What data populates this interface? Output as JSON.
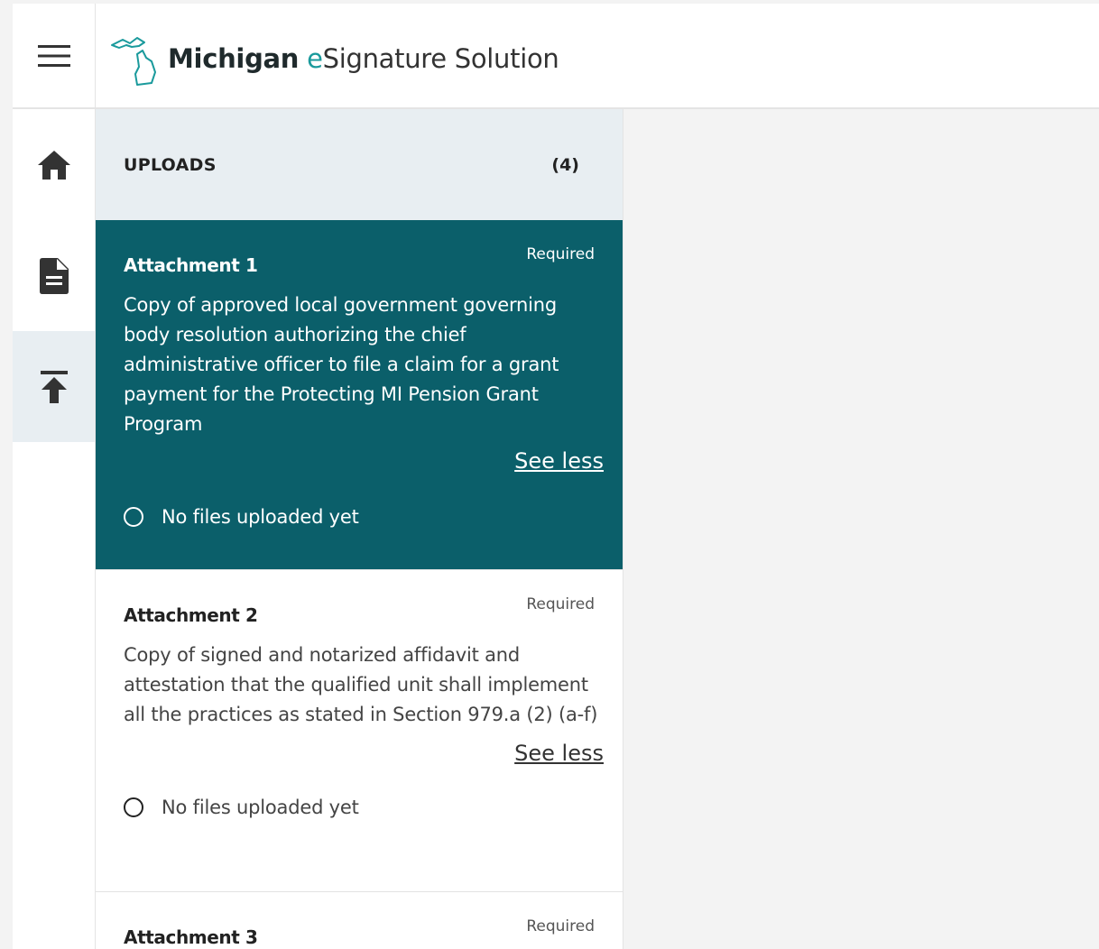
{
  "header": {
    "logo_bold": "Michigan",
    "logo_e": "e",
    "logo_rest": "Signature Solution"
  },
  "nav": {
    "items": [
      {
        "name": "home",
        "icon": "home-icon",
        "active": false
      },
      {
        "name": "documents",
        "icon": "document-icon",
        "active": false
      },
      {
        "name": "uploads",
        "icon": "upload-icon",
        "active": true
      }
    ]
  },
  "uploads": {
    "title": "UPLOADS",
    "count": "(4)",
    "items": [
      {
        "name": "Attachment 1",
        "required": "Required",
        "description": "Copy of approved local government governing body resolution authorizing the chief administrative officer to file a claim for a grant payment for the Protecting MI Pension Grant Program",
        "toggle": "See less",
        "status": "No files uploaded yet"
      },
      {
        "name": "Attachment 2",
        "required": "Required",
        "description": "Copy of signed and notarized affidavit and attestation that the qualified unit shall implement all the practices as stated in Section 979.a (2) (a-f)",
        "toggle": "See less",
        "status": "No files uploaded yet"
      },
      {
        "name": "Attachment 3",
        "required": "Required"
      }
    ]
  },
  "colors": {
    "active_card": "#0b5f6a",
    "brand_teal": "#1a9a9c",
    "panel_header": "#e8eef2"
  }
}
